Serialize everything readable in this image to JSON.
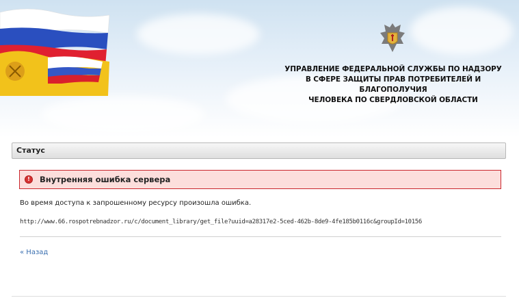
{
  "header": {
    "org_title_lines": [
      "УПРАВЛЕНИЕ ФЕДЕРАЛЬНОЙ СЛУЖБЫ ПО НАДЗОРУ",
      "В СФЕРЕ ЗАЩИТЫ ПРАВ ПОТРЕБИТЕЛЕЙ И БЛАГОПОЛУЧИЯ",
      "ЧЕЛОВЕКА ПО СВЕРДЛОВСКОЙ ОБЛАСТИ"
    ],
    "flags_icon": "russian-flags-banner",
    "emblem_icon": "rospotrebnadzor-emblem"
  },
  "status": {
    "title": "Статус"
  },
  "error": {
    "icon": "error-exclamation-icon",
    "title": "Внутренняя ошибка сервера",
    "message": "Во время доступа к запрошенному ресурсу произошла ошибка.",
    "url": "http://www.66.rospotrebnadzor.ru/c/document_library/get_file?uuid=a28317e2-5ced-462b-8de9-4fe185b0116c&groupId=10156"
  },
  "nav": {
    "back_label": "« Назад"
  },
  "colors": {
    "error_border": "#c9252c",
    "error_bg": "#fcdedc",
    "link": "#3a6fb0"
  }
}
